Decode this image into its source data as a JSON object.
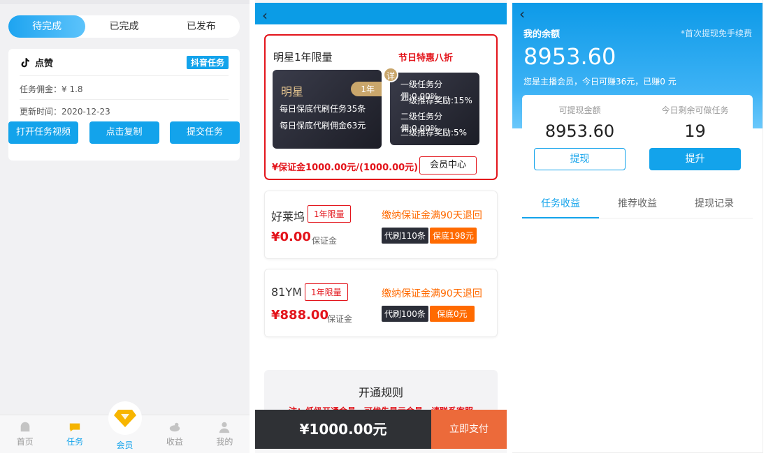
{
  "tasks": {
    "segments": [
      "待完成",
      "已完成",
      "已发布"
    ],
    "card": {
      "title": "点赞",
      "tag": "抖音任务",
      "commission": "任务佣金：¥ 1.8",
      "updated": "更新时间：2020-12-23",
      "buttons": [
        "打开任务视频",
        "点击复制",
        "提交任务"
      ]
    },
    "tabbar": [
      "首页",
      "任务",
      "会员",
      "收益",
      "我的"
    ]
  },
  "membership": {
    "featured": {
      "title": "明星1年限量",
      "promo": "节日特惠八折",
      "level_name": "明星",
      "duration": "1年",
      "lines": [
        "每日保底代刷任务35条",
        "每日保底代刷佣金63元"
      ],
      "detail_badge": "详",
      "info": [
        "一级任务分佣:0.00%",
        "一级推荐奖励:15%",
        "二级任务分佣:0.00%",
        "二级推荐奖励:5%"
      ],
      "deposit": "¥保证金1000.00元/(1000.00元)",
      "member_center": "会员中心"
    },
    "plans": [
      {
        "name": "好莱坞",
        "limit": "1年限量",
        "refund": "缴纳保证金满90天退回",
        "price": "¥0.00",
        "deposit_label": "保证金",
        "tag1": "代刷110条",
        "tag2": "保底198元"
      },
      {
        "name": "81YM",
        "limit": "1年限量",
        "refund": "缴纳保证金满90天退回",
        "price": "¥888.00",
        "deposit_label": "保证金",
        "tag1": "代刷100条",
        "tag2": "保底0元"
      }
    ],
    "rules_title": "开通规则",
    "rules_text": "注：低级开通会员，可优先显示会员，请联系客服",
    "total": "¥1000.00元",
    "pay_label": "立即支付"
  },
  "wallet": {
    "balance_label": "我的余额",
    "note": "*首次提现免手续费",
    "balance": "8953.60",
    "sub": "您是主播会员，今日可赚36元，已赚0 元",
    "withdrawable_label": "可提现金额",
    "withdrawable": "8953.60",
    "tasks_left_label": "今日剩余可做任务",
    "tasks_left": "19",
    "withdraw_btn": "提现",
    "upgrade_btn": "提升",
    "tabs": [
      "任务收益",
      "推荐收益",
      "提现记录"
    ]
  },
  "colors": {
    "accent": "#13a3eb",
    "red": "#e3141b",
    "orange": "#ff6a00"
  }
}
